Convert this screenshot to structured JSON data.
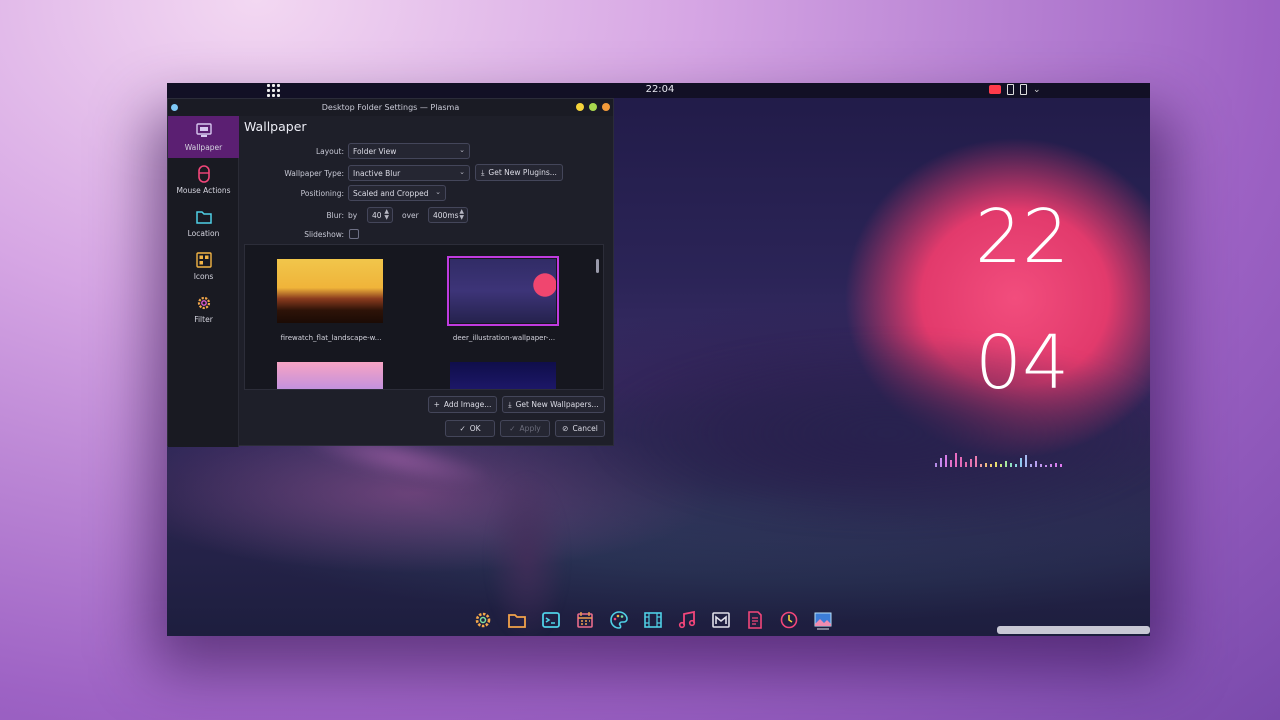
{
  "topbar": {
    "clock": "22:04"
  },
  "window": {
    "title": "Desktop Folder Settings — Plasma",
    "heading": "Wallpaper"
  },
  "sidebar": {
    "items": [
      {
        "label": "Wallpaper",
        "icon": "monitor-icon",
        "active": true
      },
      {
        "label": "Mouse Actions",
        "icon": "mouse-icon",
        "active": false
      },
      {
        "label": "Location",
        "icon": "folder-icon",
        "active": false
      },
      {
        "label": "Icons",
        "icon": "icons-grid-icon",
        "active": false
      },
      {
        "label": "Filter",
        "icon": "filter-gear-icon",
        "active": false
      }
    ]
  },
  "form": {
    "layout_label": "Layout:",
    "layout_value": "Folder View",
    "type_label": "Wallpaper Type:",
    "type_value": "Inactive Blur",
    "get_plugins": "Get New Plugins...",
    "positioning_label": "Positioning:",
    "positioning_value": "Scaled and Cropped",
    "blur_label": "Blur:",
    "blur_by": "by",
    "blur_amount": "40",
    "blur_over": "over",
    "blur_duration": "400ms",
    "slideshow_label": "Slideshow:"
  },
  "gallery": [
    {
      "caption": "firewatch_flat_landscape-w...",
      "selected": false
    },
    {
      "caption": "deer_illustration-wallpaper-...",
      "selected": true
    },
    {
      "caption": "",
      "selected": false
    },
    {
      "caption": "",
      "selected": false
    }
  ],
  "buttons": {
    "add_image": "Add Image...",
    "get_wallpapers": "Get New Wallpapers...",
    "ok": "OK",
    "apply": "Apply",
    "cancel": "Cancel"
  },
  "desktop_clock": {
    "hours": "22",
    "minutes": "04"
  },
  "dock": [
    "settings-gear-icon",
    "folder-icon",
    "terminal-icon",
    "calendar-icon",
    "palette-icon",
    "video-icon",
    "music-icon",
    "mail-icon",
    "document-icon",
    "clock-icon",
    "image-icon"
  ],
  "colors": {
    "accent": "#5b1f72",
    "sun": "#e23a6c",
    "selection": "#c03be0"
  }
}
